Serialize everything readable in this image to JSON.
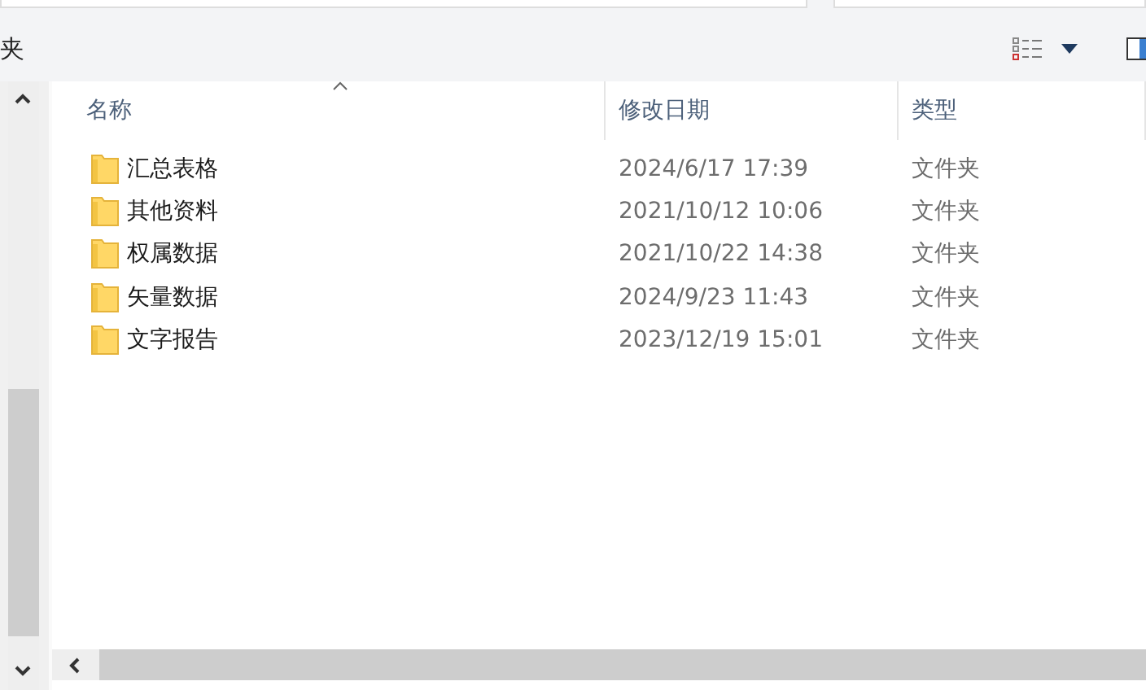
{
  "toolbar": {
    "title": "夹"
  },
  "table": {
    "columns": [
      {
        "label": "名称",
        "sorted": true
      },
      {
        "label": "修改日期",
        "sorted": false
      },
      {
        "label": "类型",
        "sorted": false
      }
    ],
    "rows": [
      {
        "name": "汇总表格",
        "modified": "2024/6/17 17:39",
        "type": "文件夹"
      },
      {
        "name": "其他资料",
        "modified": "2021/10/12 10:06",
        "type": "文件夹"
      },
      {
        "name": "权属数据",
        "modified": "2021/10/22 14:38",
        "type": "文件夹"
      },
      {
        "name": "矢量数据",
        "modified": "2024/9/23 11:43",
        "type": "文件夹"
      },
      {
        "name": "文字报告",
        "modified": "2023/12/19 15:01",
        "type": "文件夹"
      }
    ]
  }
}
